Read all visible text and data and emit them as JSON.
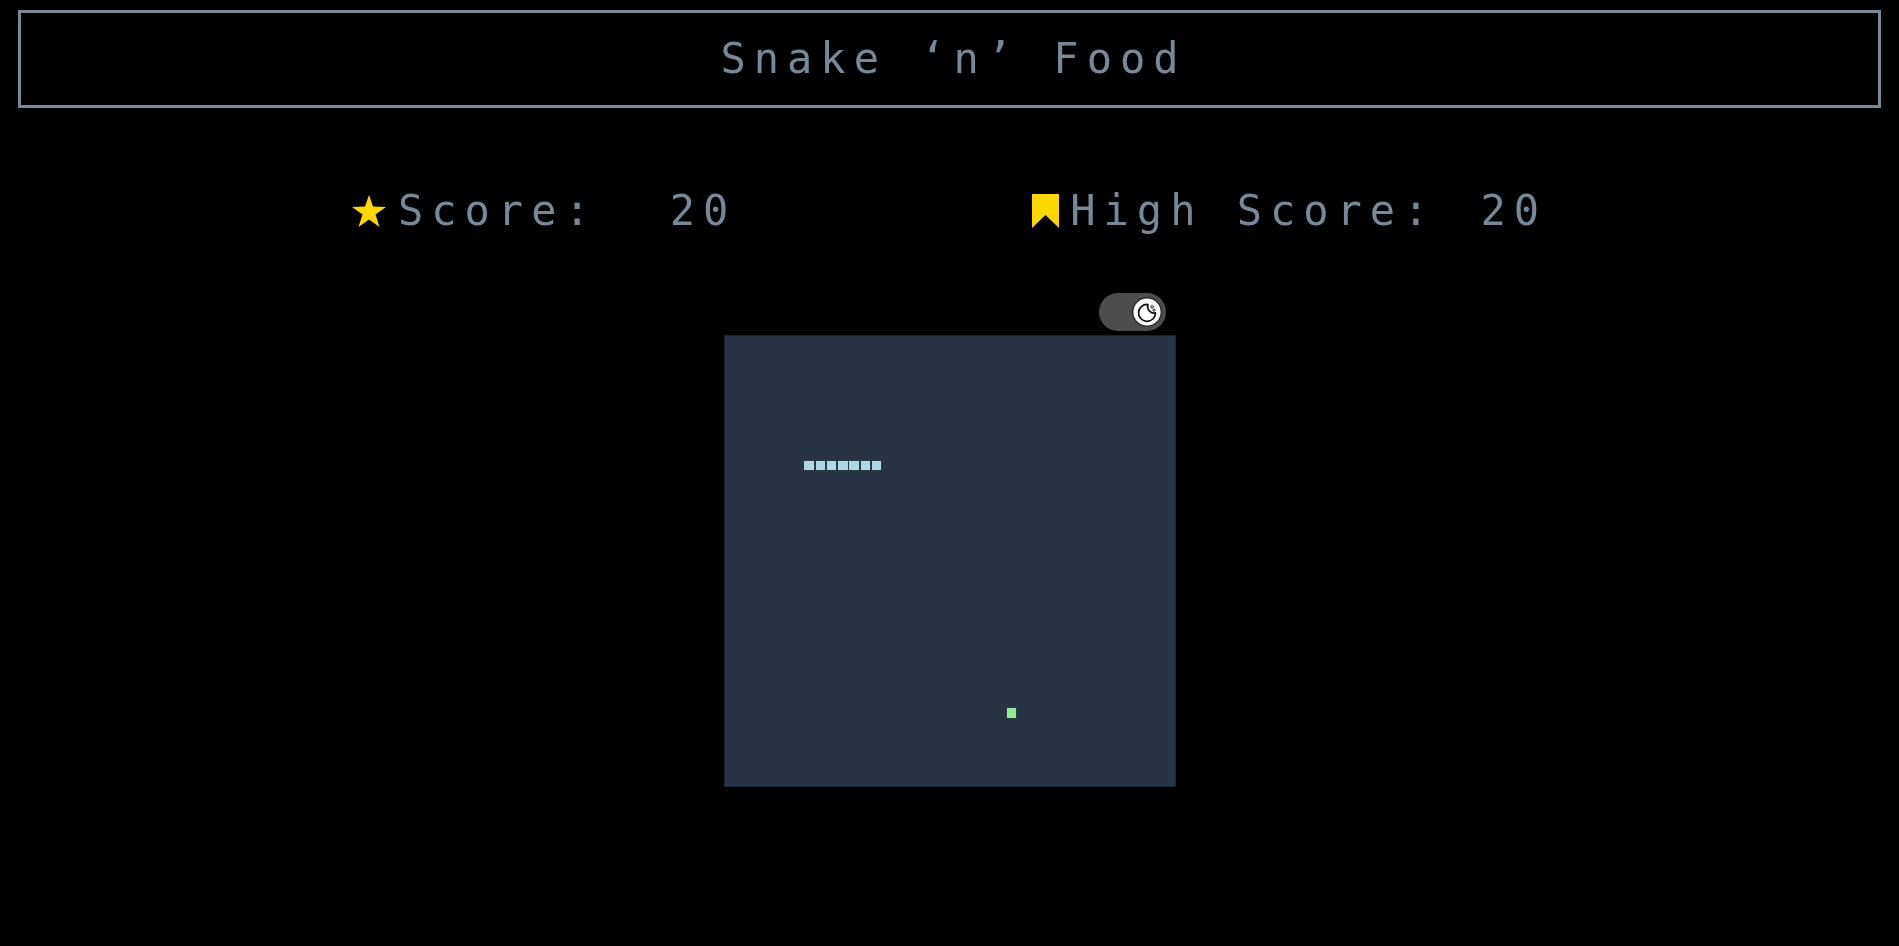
{
  "title": "Snake ‘n’ Food",
  "scores": [
    {
      "kind": "current",
      "label": "Score:",
      "value": "20"
    },
    {
      "kind": "high",
      "label": "High Score:",
      "value": "20"
    }
  ],
  "theme_toggle": {
    "on": true
  }
}
